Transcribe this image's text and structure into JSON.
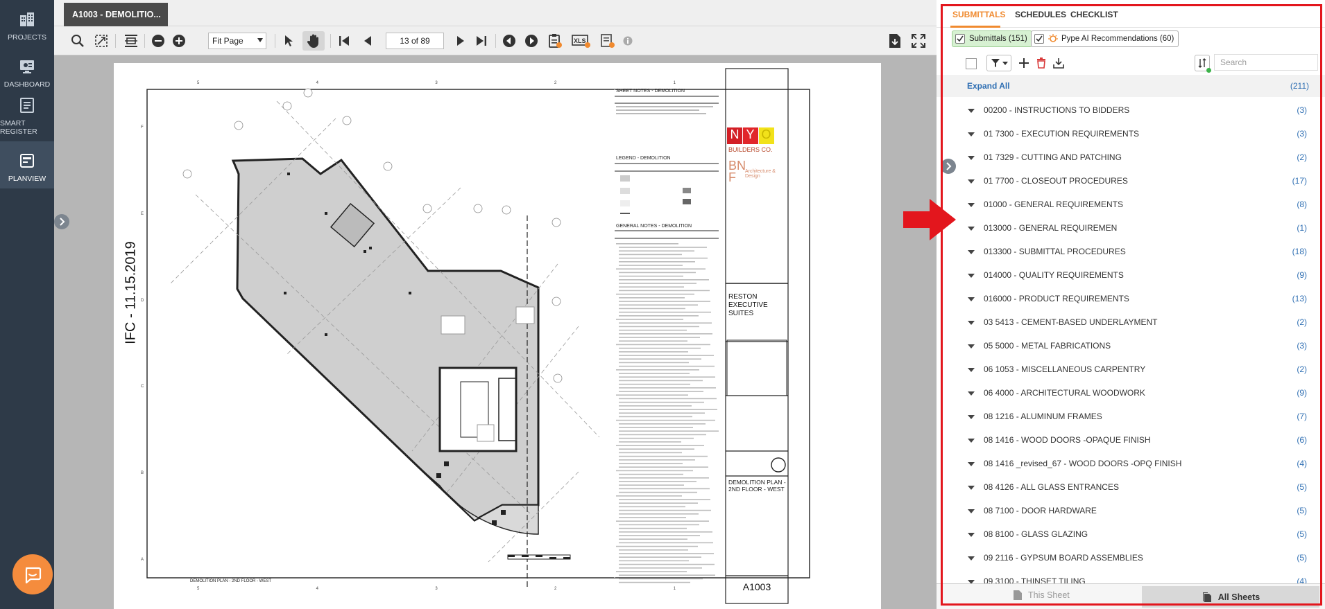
{
  "nav": {
    "items": [
      {
        "label": "PROJECTS",
        "icon": "building-icon"
      },
      {
        "label": "DASHBOARD",
        "icon": "monitor-icon"
      },
      {
        "label": "SMART REGISTER",
        "icon": "register-icon"
      },
      {
        "label": "PLANVIEW",
        "icon": "planview-icon",
        "active": true
      }
    ]
  },
  "viewer": {
    "doc_tab": "A1003 - DEMOLITIO...",
    "zoom": "Fit Page",
    "page": "13 of 89"
  },
  "sheet": {
    "stamp": "IFC - 11.15.2019",
    "sheet_notes_title": "SHEET NOTES - DEMOLITION",
    "legend_title": "LEGEND - DEMOLITION",
    "general_notes_title": "GENERAL NOTES - DEMOLITION",
    "builder_letters": [
      "N",
      "Y",
      "O"
    ],
    "builder_name": "BUILDERS CO.",
    "architect_mark": "BN F",
    "architect_name": "Architecture & Design",
    "project_name": "RESTON EXECUTIVE SUITES",
    "drawing_title": "DEMOLITION PLAN - 2ND FLOOR - WEST",
    "sheet_number": "A1003",
    "plan_caption": "DEMOLITION PLAN - 2ND FLOOR - WEST",
    "grid_top": [
      "5",
      "4",
      "3",
      "2",
      "1"
    ],
    "grid_side": [
      "F",
      "E",
      "D",
      "C",
      "B",
      "A"
    ]
  },
  "panel": {
    "tabs": [
      "SUBMITTALS",
      "SCHEDULES",
      "CHECKLIST"
    ],
    "active_tab": "SUBMITTALS",
    "filters": {
      "submittals": "Submittals (151)",
      "ai": "Pype AI Recommendations (60)"
    },
    "search_placeholder": "Search",
    "expand_all": "Expand All",
    "total": "(211)",
    "items": [
      {
        "label": "00200 - INSTRUCTIONS TO BIDDERS",
        "count": "(3)"
      },
      {
        "label": "01 7300 - EXECUTION REQUIREMENTS",
        "count": "(3)"
      },
      {
        "label": "01 7329 - CUTTING AND PATCHING",
        "count": "(2)"
      },
      {
        "label": "01 7700 - CLOSEOUT PROCEDURES",
        "count": "(17)"
      },
      {
        "label": "01000 - GENERAL REQUIREMENTS",
        "count": "(8)"
      },
      {
        "label": "013000 - GENERAL REQUIREMEN",
        "count": "(1)"
      },
      {
        "label": "013300 - SUBMITTAL PROCEDURES",
        "count": "(18)"
      },
      {
        "label": "014000 - QUALITY REQUIREMENTS",
        "count": "(9)"
      },
      {
        "label": "016000 - PRODUCT REQUIREMENTS",
        "count": "(13)"
      },
      {
        "label": "03 5413 - CEMENT-BASED UNDERLAYMENT",
        "count": "(2)"
      },
      {
        "label": "05 5000 - METAL FABRICATIONS",
        "count": "(3)"
      },
      {
        "label": "06 1053 - MISCELLANEOUS CARPENTRY",
        "count": "(2)"
      },
      {
        "label": "06 4000 - ARCHITECTURAL WOODWORK",
        "count": "(9)"
      },
      {
        "label": "08 1216 - ALUMINUM FRAMES",
        "count": "(7)"
      },
      {
        "label": "08 1416 - WOOD DOORS -OPAQUE FINISH",
        "count": "(6)"
      },
      {
        "label": "08 1416 _revised_67 - WOOD DOORS -OPQ FINISH",
        "count": "(4)"
      },
      {
        "label": "08 4126 - ALL GLASS ENTRANCES",
        "count": "(5)"
      },
      {
        "label": "08 7100 - DOOR HARDWARE",
        "count": "(5)"
      },
      {
        "label": "08 8100 - GLASS GLAZING",
        "count": "(5)"
      },
      {
        "label": "09 2116 - GYPSUM BOARD ASSEMBLIES",
        "count": "(5)"
      },
      {
        "label": "09 3100 - THINSET TILING",
        "count": "(4)"
      }
    ],
    "bottom": {
      "this_sheet": "This Sheet",
      "all_sheets": "All Sheets"
    }
  },
  "colors": {
    "nav_bg": "#2e3a48",
    "accent": "#f08a2f",
    "link": "#2f6fb3",
    "annotation_red": "#e3161d",
    "chat": "#f58c3d"
  }
}
